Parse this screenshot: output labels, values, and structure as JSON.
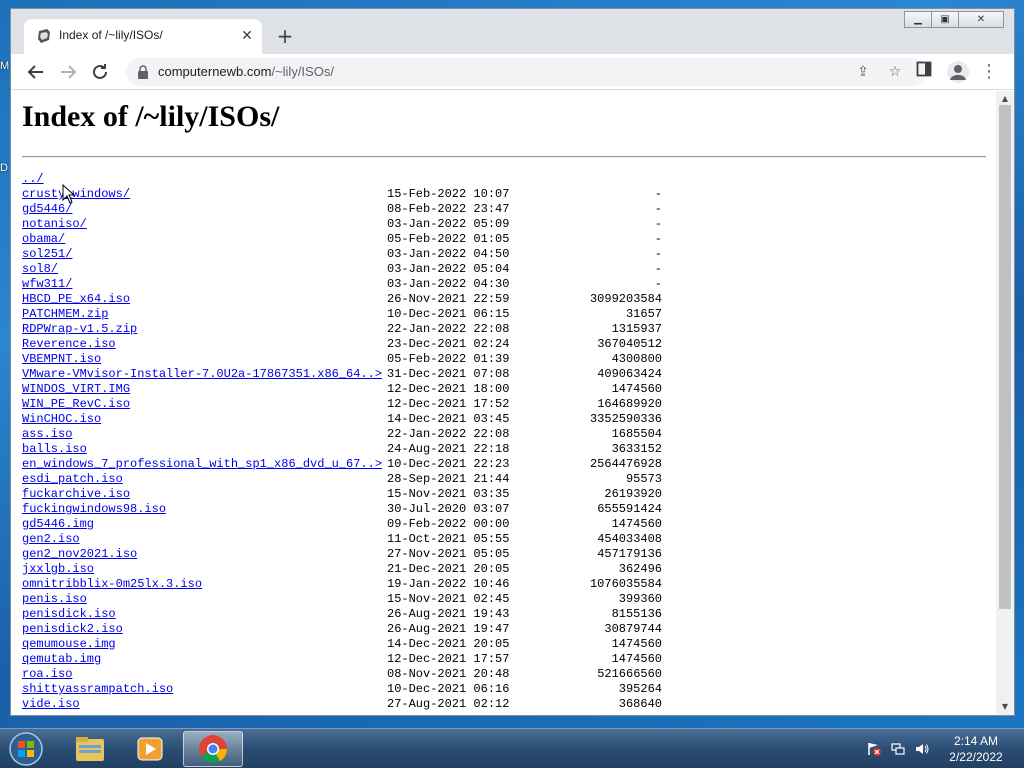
{
  "browser": {
    "tab_title": "Index of /~lily/ISOs/",
    "url_host": "computernewb.com",
    "url_path": "/~lily/ISOs/"
  },
  "page": {
    "heading": "Index of /~lily/ISOs/",
    "parent_link": "../",
    "entries": [
      {
        "name": "crusty_windows/",
        "date": "15-Feb-2022 10:07",
        "size": "-"
      },
      {
        "name": "gd5446/",
        "date": "08-Feb-2022 23:47",
        "size": "-"
      },
      {
        "name": "notaniso/",
        "date": "03-Jan-2022 05:09",
        "size": "-"
      },
      {
        "name": "obama/",
        "date": "05-Feb-2022 01:05",
        "size": "-"
      },
      {
        "name": "sol251/",
        "date": "03-Jan-2022 04:50",
        "size": "-"
      },
      {
        "name": "sol8/",
        "date": "03-Jan-2022 05:04",
        "size": "-"
      },
      {
        "name": "wfw311/",
        "date": "03-Jan-2022 04:30",
        "size": "-"
      },
      {
        "name": "HBCD_PE_x64.iso",
        "date": "26-Nov-2021 22:59",
        "size": "3099203584"
      },
      {
        "name": "PATCHMEM.zip",
        "date": "10-Dec-2021 06:15",
        "size": "31657"
      },
      {
        "name": "RDPWrap-v1.5.zip",
        "date": "22-Jan-2022 22:08",
        "size": "1315937"
      },
      {
        "name": "Reverence.iso",
        "date": "23-Dec-2021 02:24",
        "size": "367040512"
      },
      {
        "name": "VBEMPNT.iso",
        "date": "05-Feb-2022 01:39",
        "size": "4300800"
      },
      {
        "name": "VMware-VMvisor-Installer-7.0U2a-17867351.x86_64..>",
        "date": "31-Dec-2021 07:08",
        "size": "409063424"
      },
      {
        "name": "WINDOS_VIRT.IMG",
        "date": "12-Dec-2021 18:00",
        "size": "1474560"
      },
      {
        "name": "WIN_PE_RevC.iso",
        "date": "12-Dec-2021 17:52",
        "size": "164689920"
      },
      {
        "name": "WinCHOC.iso",
        "date": "14-Dec-2021 03:45",
        "size": "3352590336"
      },
      {
        "name": "ass.iso",
        "date": "22-Jan-2022 22:08",
        "size": "1685504"
      },
      {
        "name": "balls.iso",
        "date": "24-Aug-2021 22:18",
        "size": "3633152"
      },
      {
        "name": "en_windows_7_professional_with_sp1_x86_dvd_u_67..>",
        "date": "10-Dec-2021 22:23",
        "size": "2564476928"
      },
      {
        "name": "esdi_patch.iso",
        "date": "28-Sep-2021 21:44",
        "size": "95573"
      },
      {
        "name": "fuckarchive.iso",
        "date": "15-Nov-2021 03:35",
        "size": "26193920"
      },
      {
        "name": "fuckingwindows98.iso",
        "date": "30-Jul-2020 03:07",
        "size": "655591424"
      },
      {
        "name": "gd5446.img",
        "date": "09-Feb-2022 00:00",
        "size": "1474560"
      },
      {
        "name": "gen2.iso",
        "date": "11-Oct-2021 05:55",
        "size": "454033408"
      },
      {
        "name": "gen2_nov2021.iso",
        "date": "27-Nov-2021 05:05",
        "size": "457179136"
      },
      {
        "name": "jxxlgb.iso",
        "date": "21-Dec-2021 20:05",
        "size": "362496"
      },
      {
        "name": "omnitribblix-0m25lx.3.iso",
        "date": "19-Jan-2022 10:46",
        "size": "1076035584"
      },
      {
        "name": "penis.iso",
        "date": "15-Nov-2021 02:45",
        "size": "399360"
      },
      {
        "name": "penisdick.iso",
        "date": "26-Aug-2021 19:43",
        "size": "8155136"
      },
      {
        "name": "penisdick2.iso",
        "date": "26-Aug-2021 19:47",
        "size": "30879744"
      },
      {
        "name": "qemumouse.img",
        "date": "14-Dec-2021 20:05",
        "size": "1474560"
      },
      {
        "name": "qemutab.img",
        "date": "12-Dec-2021 17:57",
        "size": "1474560"
      },
      {
        "name": "roa.iso",
        "date": "08-Nov-2021 20:48",
        "size": "521666560"
      },
      {
        "name": "shittyassrampatch.iso",
        "date": "10-Dec-2021 06:16",
        "size": "395264"
      },
      {
        "name": "vide.iso",
        "date": "27-Aug-2021 02:12",
        "size": "368640"
      }
    ]
  },
  "taskbar": {
    "time": "2:14 AM",
    "date": "2/22/2022"
  },
  "desktop": {
    "icon_fragment_1": "M",
    "icon_fragment_2": "D"
  },
  "colors": {
    "link": "#0000ee",
    "chrome_frame": "#dee1e6",
    "taskbar": "#2b4e74"
  }
}
